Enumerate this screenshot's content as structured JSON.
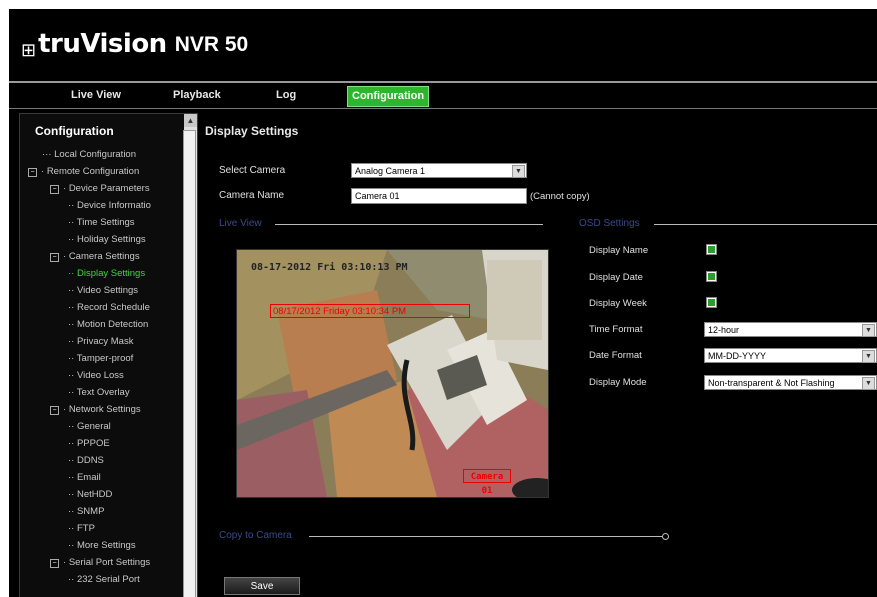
{
  "app": {
    "brand": "truVision",
    "model": "NVR 50",
    "logo_icon": "network-icon"
  },
  "nav": {
    "tabs": [
      {
        "label": "Live View"
      },
      {
        "label": "Playback"
      },
      {
        "label": "Log"
      },
      {
        "label": "Configuration",
        "active": true
      }
    ]
  },
  "sidebar": {
    "title": "Configuration",
    "items": [
      {
        "label": "Local Configuration"
      },
      {
        "label": "Remote Configuration",
        "expander": "−"
      },
      {
        "label": "Device Parameters",
        "expander": "−"
      },
      {
        "label": "Device Informatio"
      },
      {
        "label": "Time Settings"
      },
      {
        "label": "Holiday Settings"
      },
      {
        "label": "Camera Settings",
        "expander": "−"
      },
      {
        "label": "Display Settings",
        "selected": true
      },
      {
        "label": "Video Settings"
      },
      {
        "label": "Record Schedule"
      },
      {
        "label": "Motion Detection"
      },
      {
        "label": "Privacy Mask"
      },
      {
        "label": "Tamper-proof"
      },
      {
        "label": "Video Loss"
      },
      {
        "label": "Text Overlay"
      },
      {
        "label": "Network Settings",
        "expander": "−"
      },
      {
        "label": "General"
      },
      {
        "label": "PPPOE"
      },
      {
        "label": "DDNS"
      },
      {
        "label": "Email"
      },
      {
        "label": "NetHDD"
      },
      {
        "label": "SNMP"
      },
      {
        "label": "FTP"
      },
      {
        "label": "More Settings"
      },
      {
        "label": "Serial Port Settings",
        "expander": "−"
      },
      {
        "label": "232 Serial Port"
      }
    ]
  },
  "main": {
    "title": "Display Settings",
    "select_camera_label": "Select Camera",
    "select_camera_value": "Analog Camera 1",
    "camera_name_label": "Camera Name",
    "camera_name_value": "Camera 01",
    "cannot_copy": "(Cannot copy)",
    "live_view_title": "Live View",
    "osd_title": "OSD Settings",
    "copy_section_title": "Copy to Camera",
    "save_label": "Save",
    "preview": {
      "osd_datetime": "08-17-2012 Fri 03:10:13 PM",
      "red_text": "08/17/2012 Friday 03:10:34 PM",
      "camera_label": "Camera 01"
    },
    "osd": {
      "display_name_label": "Display Name",
      "display_date_label": "Display Date",
      "display_week_label": "Display Week",
      "time_format_label": "Time Format",
      "time_format_value": "12-hour",
      "date_format_label": "Date Format",
      "date_format_value": "MM-DD-YYYY",
      "display_mode_label": "Display Mode",
      "display_mode_value": "Non-transparent & Not Flashing",
      "display_name_checked": true,
      "display_date_checked": true,
      "display_week_checked": true
    }
  }
}
